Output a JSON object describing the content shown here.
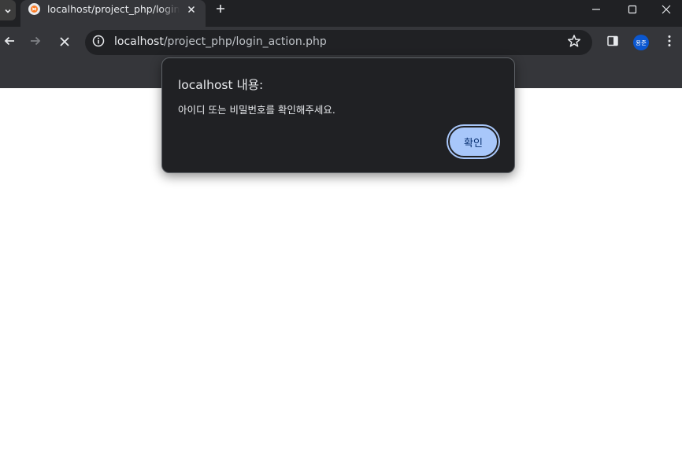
{
  "tab": {
    "title": "localhost/project_php/login_action.php",
    "favicon": "xampp-favicon-icon",
    "close": "close-icon"
  },
  "tabstrip": {
    "search_icon": "chevron-down-icon",
    "new_tab_icon": "plus-icon",
    "window_controls": [
      "minimize-icon",
      "maximize-icon",
      "close-icon"
    ]
  },
  "toolbar": {
    "back_icon": "arrow-left-icon",
    "forward_icon": "arrow-right-icon",
    "stop_icon": "stop-icon",
    "url_host": "localhost",
    "url_path": "/project_php/login_action.php",
    "site_info_icon": "info-icon",
    "bookmark_icon": "star-icon",
    "side_panel_icon": "side-panel-icon",
    "profile_initials": "용준",
    "menu_icon": "more-vertical-icon"
  },
  "dialog": {
    "title": "localhost 내용:",
    "message": "아이디 또는 비밀번호를 확인해주세요.",
    "ok_label": "확인"
  },
  "colors": {
    "chrome_dark": "#202124",
    "toolbar": "#35363a",
    "button_blue": "#a8c7fa",
    "avatar": "#0b57d0"
  }
}
